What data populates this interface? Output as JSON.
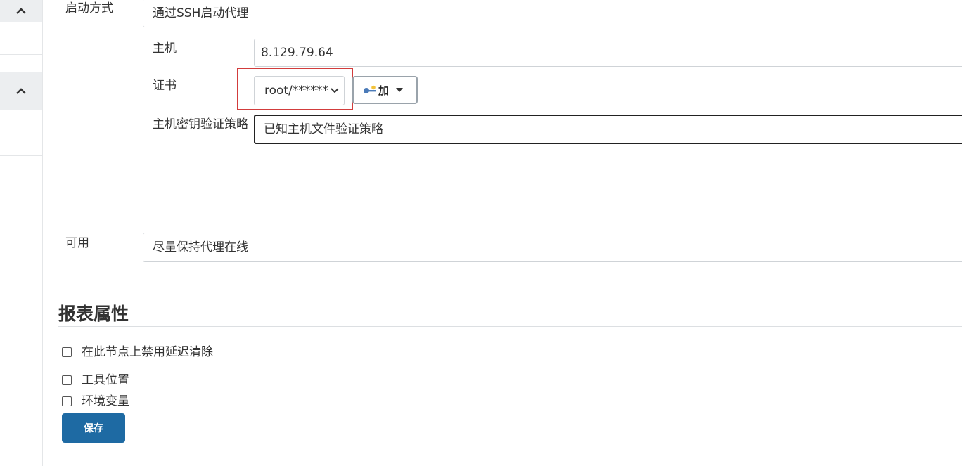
{
  "launch": {
    "label": "启动方式",
    "value": "通过SSH启动代理"
  },
  "host": {
    "label": "主机",
    "value": "8.129.79.64"
  },
  "credentials": {
    "label": "证书",
    "selected": "root/******",
    "add_label": "加"
  },
  "host_key": {
    "label": "主机密钥验证策略",
    "value": "已知主机文件验证策略"
  },
  "availability": {
    "label": "可用",
    "value": "尽量保持代理在线"
  },
  "report_section": {
    "title": "报表属性"
  },
  "options": [
    {
      "label": "在此节点上禁用延迟清除",
      "checked": false
    },
    {
      "label": "工具位置",
      "checked": false
    },
    {
      "label": "环境变量",
      "checked": false
    }
  ],
  "save_label": "保存",
  "colors": {
    "primary_button": "#1e6aa3",
    "highlight_box": "#d23c3c",
    "sidebar_tab": "#eceef0"
  }
}
